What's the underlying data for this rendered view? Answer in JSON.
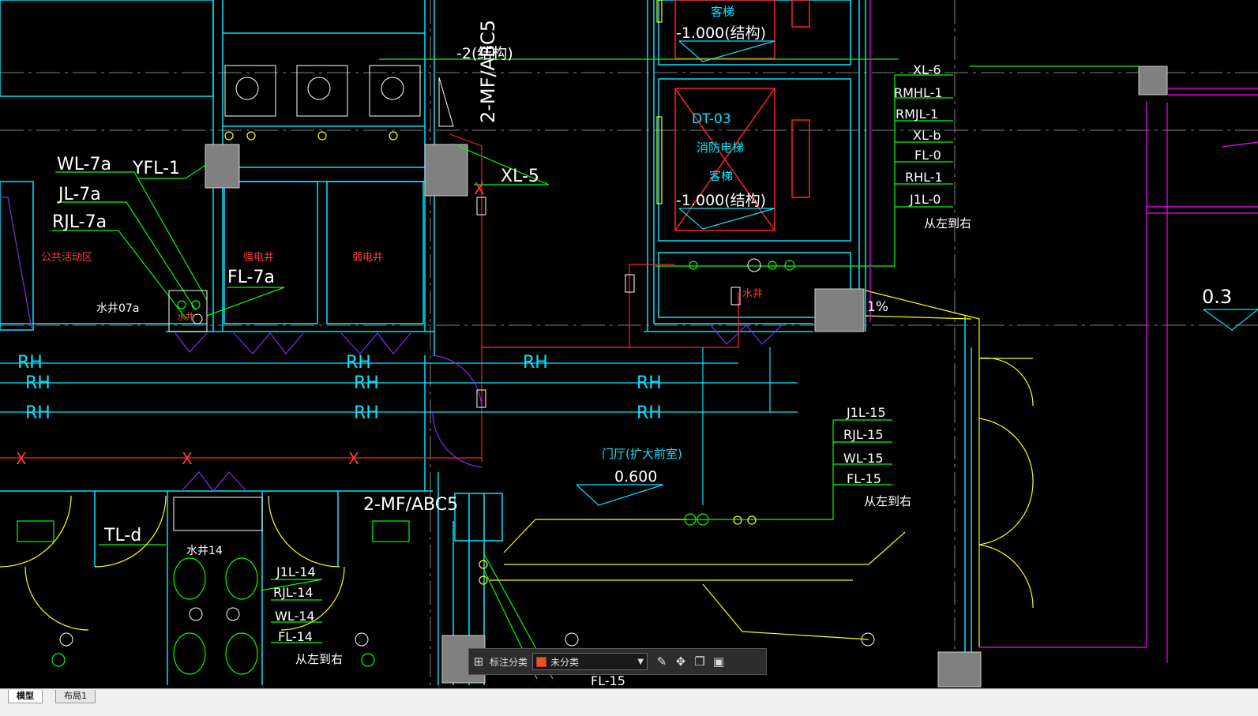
{
  "drawing": {
    "labels_red": [
      "公共活动区",
      "强电井",
      "弱电井",
      "水井",
      "水井"
    ],
    "labels_white": [
      "WL-7a",
      "JL-7a",
      "RJL-7a",
      "YFL-1",
      "FL-7a",
      "水井07a",
      "XL-5",
      "-2(结构)",
      "2-MF/ABC5",
      "TL-d",
      "水井14",
      "J1L-14",
      "RJL-14",
      "WL-14",
      "FL-14",
      "从左到右",
      "J1L-15",
      "RJL-15",
      "WL-15",
      "FL-15",
      "从左到右",
      "FL-15",
      "2-MF/ABC5"
    ],
    "elevator": {
      "top_label": "客梯",
      "top_level": "-1.000(结构)",
      "id": "DT-03",
      "fire_label": "消防电梯",
      "mid_label": "客梯",
      "level": "-1.000(结构)"
    },
    "risers_right": [
      "XL-6",
      "RMHL-1",
      "RMJL-1",
      "XL-b",
      "FL-0",
      "RHL-1",
      "J1L-0",
      "从左到右"
    ],
    "hall": {
      "name": "门厅(扩大前室)",
      "level": "0.600"
    },
    "rh_label": "RH",
    "x_label": "X",
    "slope": "1%",
    "edge_level": "0.3"
  },
  "toolbar": {
    "category_label": "标注分类",
    "selected_value": "未分类",
    "swatch_color": "#e8541c",
    "icons": [
      "grid-icon",
      "edit-icon",
      "move-icon",
      "copy-icon",
      "paste-icon"
    ]
  },
  "tabs": [
    "模型",
    "布局1"
  ],
  "colors": {
    "background": "#000000",
    "wall": "#00e5ff",
    "pipe_green": "#00ff00",
    "pipe_red": "#ff2020",
    "door": "#ffff00",
    "fixture": "#8a2be2",
    "magenta": "#ff00ff",
    "text": "#ffffff"
  }
}
